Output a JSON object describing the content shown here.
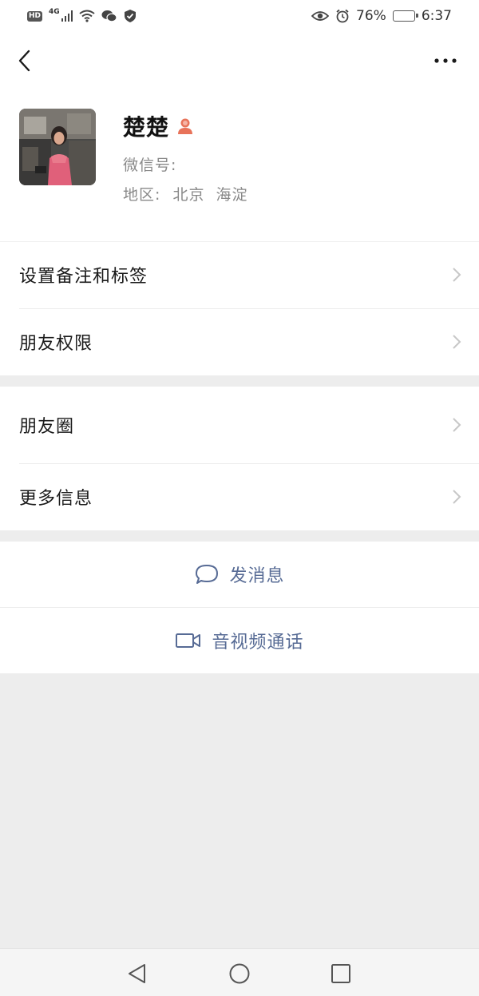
{
  "status_bar": {
    "hd_badge": "HD",
    "network": "4G",
    "battery_percent": "76%",
    "battery_level": 0.76,
    "time": "6:37",
    "icons": [
      "hd-icon",
      "signal-icon",
      "wifi-icon",
      "wechat-icon",
      "shield-icon",
      "eye-icon",
      "alarm-icon",
      "battery-icon"
    ]
  },
  "nav": {
    "back_icon": "chevron-left-icon",
    "more_icon": "more-dots-icon"
  },
  "profile": {
    "name": "楚楚",
    "gender_icon": "female-icon",
    "wechat_id_label": "微信号:",
    "region_label": "地区:",
    "region_value": "北京  海淀"
  },
  "menu": {
    "remark_tags": "设置备注和标签",
    "permissions": "朋友权限",
    "moments": "朋友圈",
    "more_info": "更多信息"
  },
  "actions": {
    "send_message": "发消息",
    "video_call": "音视频通话"
  },
  "colors": {
    "link_blue": "#576b95",
    "background": "#ededed",
    "female_badge": "#e8735a"
  }
}
